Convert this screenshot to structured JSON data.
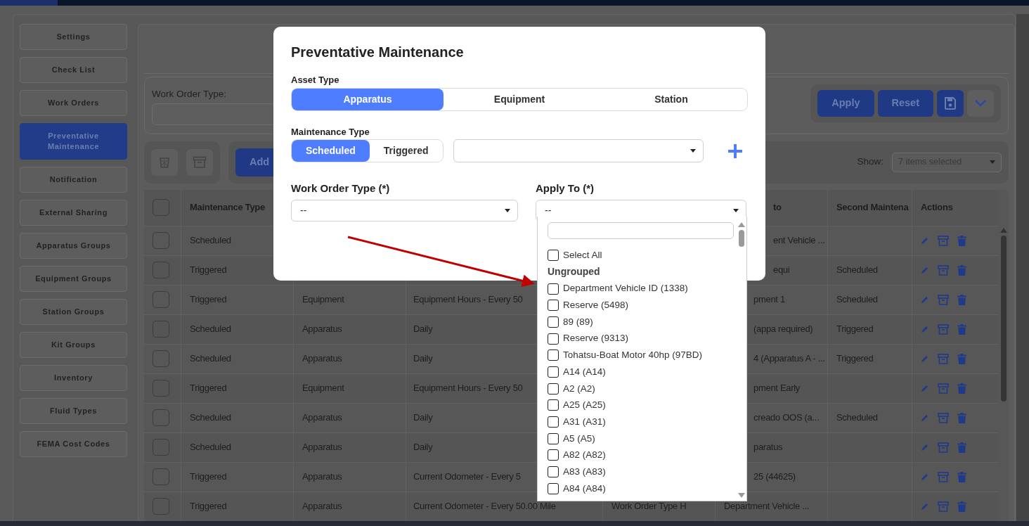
{
  "sidebar": {
    "items": [
      {
        "label": "Settings",
        "selected": false
      },
      {
        "label": "Check List",
        "selected": false
      },
      {
        "label": "Work Orders",
        "selected": false
      },
      {
        "label": "Preventative Maintenance",
        "selected": true
      },
      {
        "label": "Notification",
        "selected": false
      },
      {
        "label": "External Sharing",
        "selected": false
      },
      {
        "label": "Apparatus Groups",
        "selected": false
      },
      {
        "label": "Equipment Groups",
        "selected": false
      },
      {
        "label": "Station Groups",
        "selected": false
      },
      {
        "label": "Kit Groups",
        "selected": false
      },
      {
        "label": "Inventory",
        "selected": false
      },
      {
        "label": "Fluid Types",
        "selected": false
      },
      {
        "label": "FEMA Cost Codes",
        "selected": false
      }
    ]
  },
  "filters": {
    "work_order_type_label": "Work Order Type:",
    "apply_button": "Apply",
    "reset_button": "Reset"
  },
  "toolbar": {
    "add_button": "Add",
    "show_label": "Show:",
    "show_value": "7 items selected"
  },
  "table": {
    "header_checked": false,
    "columns": {
      "column_1": "Maintenance Type",
      "column_5": "to",
      "column_6": "Second Maintena",
      "column_7": "Actions"
    },
    "rows": [
      {
        "checked": false,
        "column_1": "Scheduled",
        "column_5": "ent Vehicle ..."
      },
      {
        "checked": false,
        "column_1": "Triggered",
        "column_5": "equi",
        "column_6": "Scheduled"
      },
      {
        "checked": false,
        "column_1": "Triggered",
        "column_2": "Equipment",
        "column_3": "Equipment Hours - Every 50",
        "column_5": "pment 1",
        "column_6": "Scheduled"
      },
      {
        "checked": false,
        "column_1": "Scheduled",
        "column_2": "Apparatus",
        "column_3": "Daily",
        "column_5": "(appa required)",
        "column_6": "Triggered"
      },
      {
        "checked": false,
        "column_1": "Scheduled",
        "column_2": "Apparatus",
        "column_3": "Daily",
        "column_5": "4 (Apparatus A - ...",
        "column_6": "Triggered"
      },
      {
        "checked": false,
        "column_1": "Triggered",
        "column_2": "Equipment",
        "column_3": "Equipment Hours - Every 50",
        "column_5": "pment Early"
      },
      {
        "checked": false,
        "column_1": "Scheduled",
        "column_2": "Apparatus",
        "column_3": "Daily",
        "column_5": "creado OOS (a...",
        "column_6": "Scheduled"
      },
      {
        "checked": false,
        "column_1": "Scheduled",
        "column_2": "Apparatus",
        "column_3": "Daily",
        "column_5": "paratus"
      },
      {
        "checked": false,
        "column_1": "Triggered",
        "column_2": "Apparatus",
        "column_3": "Current Odometer - Every 5",
        "column_5": "25 (44625)"
      },
      {
        "checked": false,
        "column_1": "Triggered",
        "column_2": "Apparatus",
        "column_3": "Current Odometer - Every 50.00 Mile",
        "column_4": "Work Order Type H",
        "column_5": "Department Vehicle ..."
      }
    ]
  },
  "modal": {
    "title": "Preventative Maintenance",
    "asset_type": {
      "label": "Asset Type",
      "options": [
        {
          "label": "Apparatus",
          "selected": true
        },
        {
          "label": "Equipment",
          "selected": false
        },
        {
          "label": "Station",
          "selected": false
        }
      ]
    },
    "maintenance_type": {
      "label": "Maintenance Type",
      "options": [
        {
          "label": "Scheduled",
          "selected": true
        },
        {
          "label": "Triggered",
          "selected": false
        }
      ]
    },
    "work_order_type": {
      "label": "Work Order Type (*)",
      "value": "--"
    },
    "apply_to": {
      "label": "Apply To (*)",
      "value": "--",
      "dropdown": {
        "select_all": {
          "label": "Select All",
          "checked": false
        },
        "groups": [
          {
            "label": "Ungrouped",
            "items": [
              {
                "label": "Department Vehicle ID (1338)",
                "checked": false
              },
              {
                "label": "Reserve (5498)",
                "checked": false
              },
              {
                "label": "89 (89)",
                "checked": false
              },
              {
                "label": "Reserve (9313)",
                "checked": false
              },
              {
                "label": "Tohatsu-Boat Motor 40hp (97BD)",
                "checked": false
              },
              {
                "label": "A14 (A14)",
                "checked": false
              },
              {
                "label": "A2 (A2)",
                "checked": false
              },
              {
                "label": "A25 (A25)",
                "checked": false
              },
              {
                "label": "A31 (A31)",
                "checked": false
              },
              {
                "label": "A5 (A5)",
                "checked": false
              },
              {
                "label": "A82 (A82)",
                "checked": false
              },
              {
                "label": "A83 (A83)",
                "checked": false
              },
              {
                "label": "A84 (A84)",
                "checked": false
              }
            ]
          }
        ]
      }
    }
  }
}
